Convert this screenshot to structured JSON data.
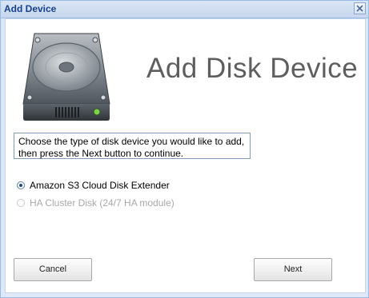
{
  "dialog": {
    "title": "Add Device",
    "close_icon": "close-icon"
  },
  "header": {
    "heading": "Add Disk Device",
    "image": "hard-disk-icon"
  },
  "instructions": "Choose the type of disk device you would like to add, then press the Next button to continue.",
  "options": [
    {
      "label": "Amazon S3 Cloud Disk Extender",
      "selected": true,
      "enabled": true
    },
    {
      "label": "HA Cluster Disk (24/7 HA module)",
      "selected": false,
      "enabled": false
    }
  ],
  "buttons": {
    "cancel": "Cancel",
    "next": "Next"
  },
  "colors": {
    "title_text": "#15428b",
    "frame_border": "#99bbe8",
    "heading_text": "#5e5e5e"
  }
}
